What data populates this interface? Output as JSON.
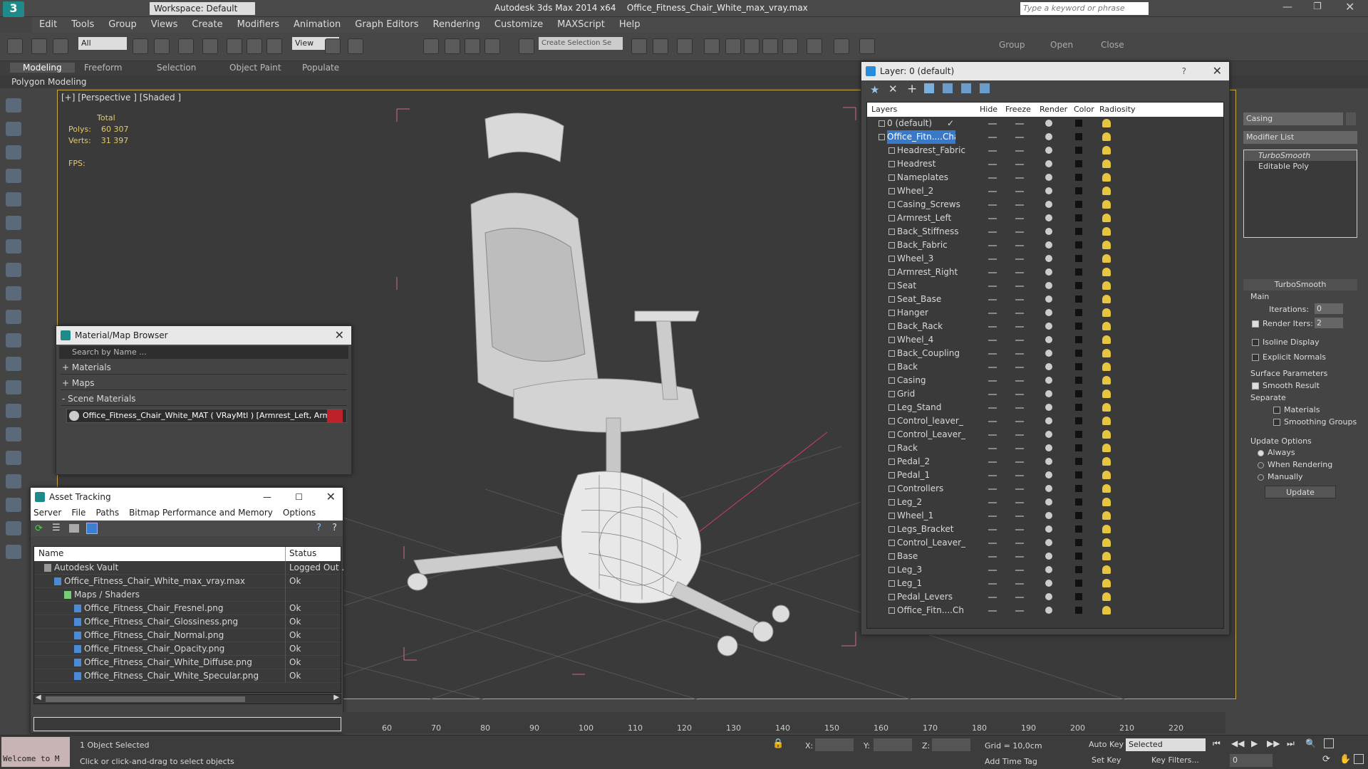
{
  "app": {
    "title": "Autodesk 3ds Max  2014 x64",
    "file_title": "Office_Fitness_Chair_White_max_vray.max",
    "workspace": "Workspace: Default",
    "search_placeholder": "Type a keyword or phrase"
  },
  "menu": [
    "Edit",
    "Tools",
    "Group",
    "Views",
    "Create",
    "Modifiers",
    "Animation",
    "Graph Editors",
    "Rendering",
    "Customize",
    "MAXScript",
    "Help"
  ],
  "toolbar": {
    "filter_value": "All",
    "view_value": "View",
    "selection_set_placeholder": "Create Selection Se",
    "group_label": "Group",
    "open_label": "Open",
    "close_label": "Close"
  },
  "ribbon": {
    "tabs": [
      "Modeling",
      "Freeform",
      "Selection",
      "Object Paint",
      "Populate"
    ],
    "subtab": "Polygon Modeling"
  },
  "viewport": {
    "label": "[+] [Perspective ] [Shaded ]",
    "stats_header": "Total",
    "polys_label": "Polys:",
    "polys_value": "60 307",
    "verts_label": "Verts:",
    "verts_value": "31 397",
    "fps_label": "FPS:"
  },
  "layer_dialog": {
    "title": "Layer: 0 (default)",
    "help": "?",
    "columns": [
      "Layers",
      "Hide",
      "Freeze",
      "Render",
      "Color",
      "Radiosity"
    ],
    "default_layer": "0 (default)",
    "parent_layer": "Office_Fitn....Chair",
    "objects": [
      "Headrest_Fabric",
      "Headrest",
      "Nameplates",
      "Wheel_2",
      "Casing_Screws",
      "Armrest_Left",
      "Back_Stiffness",
      "Back_Fabric",
      "Wheel_3",
      "Armrest_Right",
      "Seat",
      "Seat_Base",
      "Hanger",
      "Back_Rack",
      "Wheel_4",
      "Back_Coupling",
      "Back",
      "Casing",
      "Grid",
      "Leg_Stand",
      "Control_leaver_",
      "Control_Leaver_",
      "Rack",
      "Pedal_2",
      "Pedal_1",
      "Controllers",
      "Leg_2",
      "Wheel_1",
      "Legs_Bracket",
      "Control_Leaver_",
      "Base",
      "Leg_3",
      "Leg_1",
      "Pedal_Levers",
      "Office_Fitn....Ch"
    ]
  },
  "material_browser": {
    "title": "Material/Map Browser",
    "search_placeholder": "Search by Name ...",
    "sections": [
      "+ Materials",
      "+ Maps",
      "- Scene Materials"
    ],
    "scene_material": "Office_Fitness_Chair_White_MAT  ( VRayMtl ) [Armrest_Left, Armres..."
  },
  "asset_tracking": {
    "title": "Asset Tracking",
    "menu": [
      "Server",
      "File",
      "Paths",
      "Bitmap Performance and Memory",
      "Options"
    ],
    "col_name": "Name",
    "col_status": "Status",
    "rows": [
      {
        "name": "Autodesk Vault",
        "status": "Logged Out ."
      },
      {
        "name": "Office_Fitness_Chair_White_max_vray.max",
        "status": "Ok"
      },
      {
        "name": "Maps / Shaders",
        "status": ""
      },
      {
        "name": "Office_Fitness_Chair_Fresnel.png",
        "status": "Ok"
      },
      {
        "name": "Office_Fitness_Chair_Glossiness.png",
        "status": "Ok"
      },
      {
        "name": "Office_Fitness_Chair_Normal.png",
        "status": "Ok"
      },
      {
        "name": "Office_Fitness_Chair_Opacity.png",
        "status": "Ok"
      },
      {
        "name": "Office_Fitness_Chair_White_Diffuse.png",
        "status": "Ok"
      },
      {
        "name": "Office_Fitness_Chair_White_Specular.png",
        "status": "Ok"
      }
    ]
  },
  "command_panel": {
    "object_name": "Casing",
    "modifier_list": "Modifier List",
    "stack": [
      "TurboSmooth",
      "Editable Poly"
    ],
    "rollout": "TurboSmooth",
    "main": "Main",
    "iterations_label": "Iterations:",
    "iterations_value": "0",
    "render_iters_label": "Render Iters:",
    "render_iters_value": "2",
    "isoline": "Isoline Display",
    "explicit": "Explicit Normals",
    "surface": "Surface Parameters",
    "smooth": "Smooth Result",
    "separate": "Separate",
    "materials": "Materials",
    "smoothing_groups": "Smoothing Groups",
    "update_options": "Update Options",
    "always": "Always",
    "when_rendering": "When Rendering",
    "manually": "Manually",
    "update_btn": "Update"
  },
  "timeline": {
    "ticks": [
      "60",
      "70",
      "80",
      "90",
      "100",
      "110",
      "120",
      "130",
      "140",
      "150",
      "160",
      "170",
      "180",
      "190",
      "200",
      "210",
      "220"
    ]
  },
  "status": {
    "maxscript": "Welcome to M",
    "selected": "1 Object Selected",
    "prompt": "Click or click-and-drag to select objects",
    "x_label": "X:",
    "y_label": "Y:",
    "z_label": "Z:",
    "grid": "Grid = 10,0cm",
    "add_time_tag": "Add Time Tag",
    "auto_key": "Auto Key",
    "set_key": "Set Key",
    "selected_value": "Selected",
    "key_filters": "Key Filters...",
    "frame": "0"
  }
}
